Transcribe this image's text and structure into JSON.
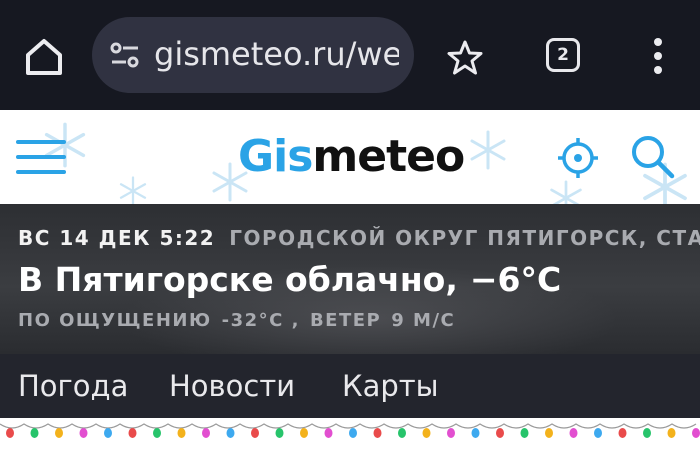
{
  "browser": {
    "url": "gismeteo.ru/weat",
    "tab_count": "2"
  },
  "site": {
    "logo_gis": "Gis",
    "logo_meteo": "meteo"
  },
  "weather": {
    "date": "ВС 14 ДЕК 5:22",
    "location": "ГОРОДСКОЙ ОКРУГ ПЯТИГОРСК, СТАВРОПО",
    "headline": "В Пятигорске облачно,",
    "temperature": "−6°C",
    "feels_label": "ПО ОЩУЩЕНИЮ",
    "feels_value": "-32°C ,",
    "wind_label": "ВЕТЕР",
    "wind_value": "9 М/С"
  },
  "nav": {
    "items": [
      "Погода",
      "Новости",
      "Карты"
    ]
  },
  "colors": {
    "brand_blue": "#2aa3e6",
    "browser_bg": "#161821",
    "nav_bg": "#23252d"
  },
  "icons": [
    "home-icon",
    "site-settings-icon",
    "star-icon",
    "tabs-icon",
    "more-icon",
    "hamburger-icon",
    "locate-icon",
    "search-icon",
    "snowflake-icon"
  ]
}
